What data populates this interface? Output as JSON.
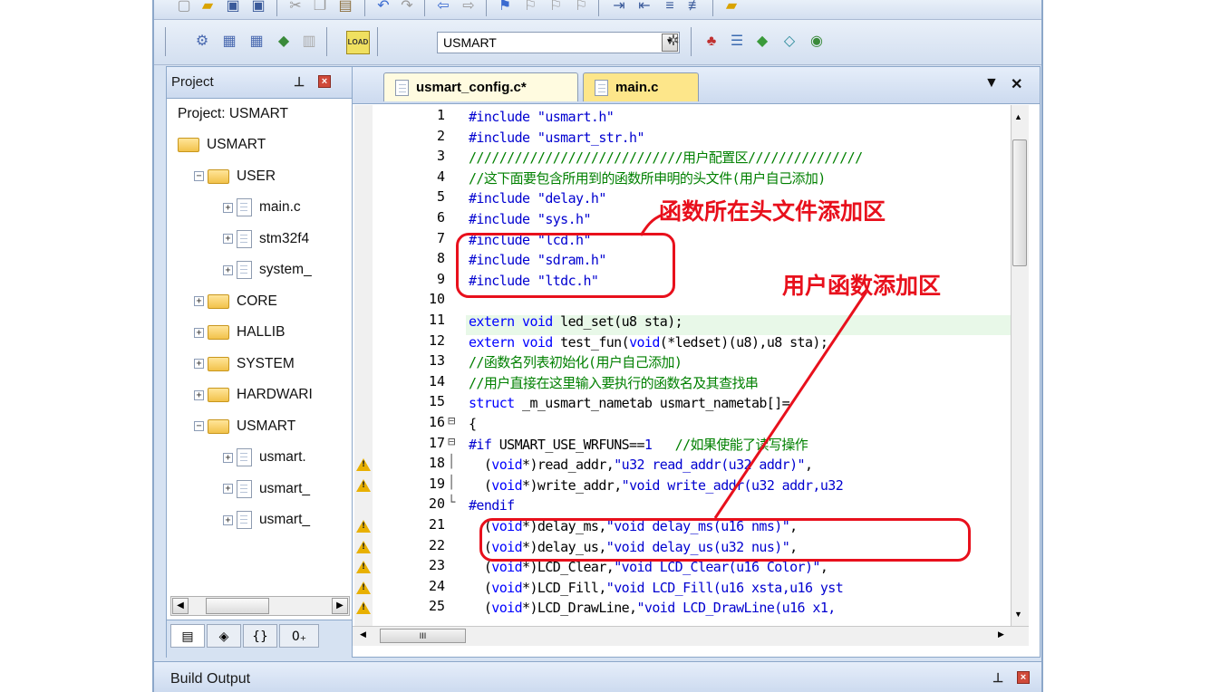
{
  "toolbar": {
    "target_select": "USMART",
    "load_label": "LOAD"
  },
  "project_panel": {
    "title": "Project",
    "root_label": "Project: USMART",
    "tree": [
      {
        "label": "USMART",
        "level": 0,
        "type": "target"
      },
      {
        "label": "USER",
        "level": 1,
        "type": "folder-open",
        "toggle": "−"
      },
      {
        "label": "main.c",
        "level": 2,
        "type": "file",
        "toggle": "+"
      },
      {
        "label": "stm32f4",
        "level": 2,
        "type": "file",
        "toggle": "+"
      },
      {
        "label": "system_",
        "level": 2,
        "type": "file",
        "toggle": "+"
      },
      {
        "label": "CORE",
        "level": 1,
        "type": "folder",
        "toggle": "+"
      },
      {
        "label": "HALLIB",
        "level": 1,
        "type": "folder",
        "toggle": "+"
      },
      {
        "label": "SYSTEM",
        "level": 1,
        "type": "folder",
        "toggle": "+"
      },
      {
        "label": "HARDWARI",
        "level": 1,
        "type": "folder",
        "toggle": "+"
      },
      {
        "label": "USMART",
        "level": 1,
        "type": "folder-open",
        "toggle": "−"
      },
      {
        "label": "usmart.",
        "level": 2,
        "type": "file",
        "toggle": "+"
      },
      {
        "label": "usmart_",
        "level": 2,
        "type": "file",
        "toggle": "+"
      },
      {
        "label": "usmart_",
        "level": 2,
        "type": "file",
        "toggle": "+"
      }
    ],
    "bottom_tabs": [
      "▤",
      "◈",
      "{}",
      "0₊"
    ]
  },
  "editor": {
    "tabs": [
      {
        "label": "usmart_config.c*",
        "active": true
      },
      {
        "label": "main.c",
        "active": false
      }
    ],
    "lines": [
      {
        "n": "1",
        "fold": "",
        "warn": false,
        "tokens": [
          [
            "c-pre",
            "#include "
          ],
          [
            "c-str",
            "\"usmart.h\""
          ]
        ]
      },
      {
        "n": "2",
        "fold": "",
        "warn": false,
        "tokens": [
          [
            "c-pre",
            "#include "
          ],
          [
            "c-str",
            "\"usmart_str.h\""
          ]
        ]
      },
      {
        "n": "3",
        "fold": "",
        "warn": false,
        "tokens": [
          [
            "c-com",
            "////////////////////////////用户配置区///////////////"
          ]
        ]
      },
      {
        "n": "4",
        "fold": "",
        "warn": false,
        "tokens": [
          [
            "c-com",
            "//这下面要包含所用到的函数所申明的头文件(用户自己添加)"
          ]
        ]
      },
      {
        "n": "5",
        "fold": "",
        "warn": false,
        "tokens": [
          [
            "c-pre",
            "#include "
          ],
          [
            "c-str",
            "\"delay.h\""
          ]
        ]
      },
      {
        "n": "6",
        "fold": "",
        "warn": false,
        "tokens": [
          [
            "c-pre",
            "#include "
          ],
          [
            "c-str",
            "\"sys.h\""
          ]
        ]
      },
      {
        "n": "7",
        "fold": "",
        "warn": false,
        "tokens": [
          [
            "c-pre",
            "#include "
          ],
          [
            "c-str",
            "\"lcd.h\""
          ]
        ]
      },
      {
        "n": "8",
        "fold": "",
        "warn": false,
        "tokens": [
          [
            "c-pre",
            "#include "
          ],
          [
            "c-str",
            "\"sdram.h\""
          ]
        ]
      },
      {
        "n": "9",
        "fold": "",
        "warn": false,
        "tokens": [
          [
            "c-pre",
            "#include "
          ],
          [
            "c-str",
            "\"ltdc.h\""
          ]
        ]
      },
      {
        "n": "10",
        "fold": "",
        "warn": false,
        "tokens": []
      },
      {
        "n": "11",
        "fold": "",
        "warn": false,
        "tokens": [
          [
            "c-key",
            "extern void "
          ],
          [
            "c-txt",
            "led_set(u8 sta);"
          ]
        ]
      },
      {
        "n": "12",
        "fold": "",
        "warn": false,
        "tokens": [
          [
            "c-key",
            "extern void "
          ],
          [
            "c-txt",
            "test_fun("
          ],
          [
            "c-key",
            "void"
          ],
          [
            "c-txt",
            "(*ledset)(u8),u8 sta);"
          ]
        ]
      },
      {
        "n": "13",
        "fold": "",
        "warn": false,
        "tokens": [
          [
            "c-com",
            "//函数名列表初始化(用户自己添加)"
          ]
        ]
      },
      {
        "n": "14",
        "fold": "",
        "warn": false,
        "tokens": [
          [
            "c-com",
            "//用户直接在这里输入要执行的函数名及其查找串"
          ]
        ]
      },
      {
        "n": "15",
        "fold": "",
        "warn": false,
        "tokens": [
          [
            "c-key",
            "struct "
          ],
          [
            "c-txt",
            "_m_usmart_nametab usmart_nametab[]="
          ]
        ]
      },
      {
        "n": "16",
        "fold": "⊟",
        "warn": false,
        "tokens": [
          [
            "c-txt",
            "{"
          ]
        ]
      },
      {
        "n": "17",
        "fold": "⊟",
        "warn": false,
        "tokens": [
          [
            "c-pre",
            "#if "
          ],
          [
            "c-txt",
            "USMART_USE_WRFUNS=="
          ],
          [
            "c-str",
            "1 "
          ],
          [
            "c-com",
            "  //如果使能了读写操作"
          ]
        ]
      },
      {
        "n": "18",
        "fold": "│",
        "warn": true,
        "tokens": [
          [
            "c-txt",
            "  ("
          ],
          [
            "c-key",
            "void"
          ],
          [
            "c-txt",
            "*)read_addr,"
          ],
          [
            "c-str",
            "\"u32 read_addr(u32 addr)\""
          ],
          [
            "c-txt",
            ","
          ]
        ]
      },
      {
        "n": "19",
        "fold": "│",
        "warn": true,
        "tokens": [
          [
            "c-txt",
            "  ("
          ],
          [
            "c-key",
            "void"
          ],
          [
            "c-txt",
            "*)write_addr,"
          ],
          [
            "c-str",
            "\"void write_addr(u32 addr,u32"
          ]
        ]
      },
      {
        "n": "20",
        "fold": "└",
        "warn": false,
        "tokens": [
          [
            "c-pre",
            "#endif"
          ]
        ]
      },
      {
        "n": "21",
        "fold": "",
        "warn": true,
        "tokens": [
          [
            "c-txt",
            "  ("
          ],
          [
            "c-key",
            "void"
          ],
          [
            "c-txt",
            "*)delay_ms,"
          ],
          [
            "c-str",
            "\"void delay_ms(u16 nms)\""
          ],
          [
            "c-txt",
            ","
          ]
        ]
      },
      {
        "n": "22",
        "fold": "",
        "warn": true,
        "tokens": [
          [
            "c-txt",
            "  ("
          ],
          [
            "c-key",
            "void"
          ],
          [
            "c-txt",
            "*)delay_us,"
          ],
          [
            "c-str",
            "\"void delay_us(u32 nus)\""
          ],
          [
            "c-txt",
            ","
          ]
        ]
      },
      {
        "n": "23",
        "fold": "",
        "warn": true,
        "tokens": [
          [
            "c-txt",
            "  ("
          ],
          [
            "c-key",
            "void"
          ],
          [
            "c-txt",
            "*)LCD_Clear,"
          ],
          [
            "c-str",
            "\"void LCD_Clear(u16 Color)\""
          ],
          [
            "c-txt",
            ","
          ]
        ]
      },
      {
        "n": "24",
        "fold": "",
        "warn": true,
        "tokens": [
          [
            "c-txt",
            "  ("
          ],
          [
            "c-key",
            "void"
          ],
          [
            "c-txt",
            "*)LCD_Fill,"
          ],
          [
            "c-str",
            "\"void LCD_Fill(u16 xsta,u16 yst"
          ]
        ]
      },
      {
        "n": "25",
        "fold": "",
        "warn": true,
        "tokens": [
          [
            "c-txt",
            "  ("
          ],
          [
            "c-key",
            "void"
          ],
          [
            "c-txt",
            "*)LCD_DrawLine,"
          ],
          [
            "c-str",
            "\"void LCD_DrawLine(u16 x1,"
          ]
        ]
      }
    ],
    "hscroll_label": "III"
  },
  "annotations": {
    "header_area": "函数所在头文件添加区",
    "function_area": "用户函数添加区"
  },
  "build_output": {
    "title": "Build Output"
  },
  "colors": {
    "annotation": "#e8101c",
    "preprocessor": "#0000d0",
    "comment": "#008000",
    "keyword": "#0000ff"
  }
}
